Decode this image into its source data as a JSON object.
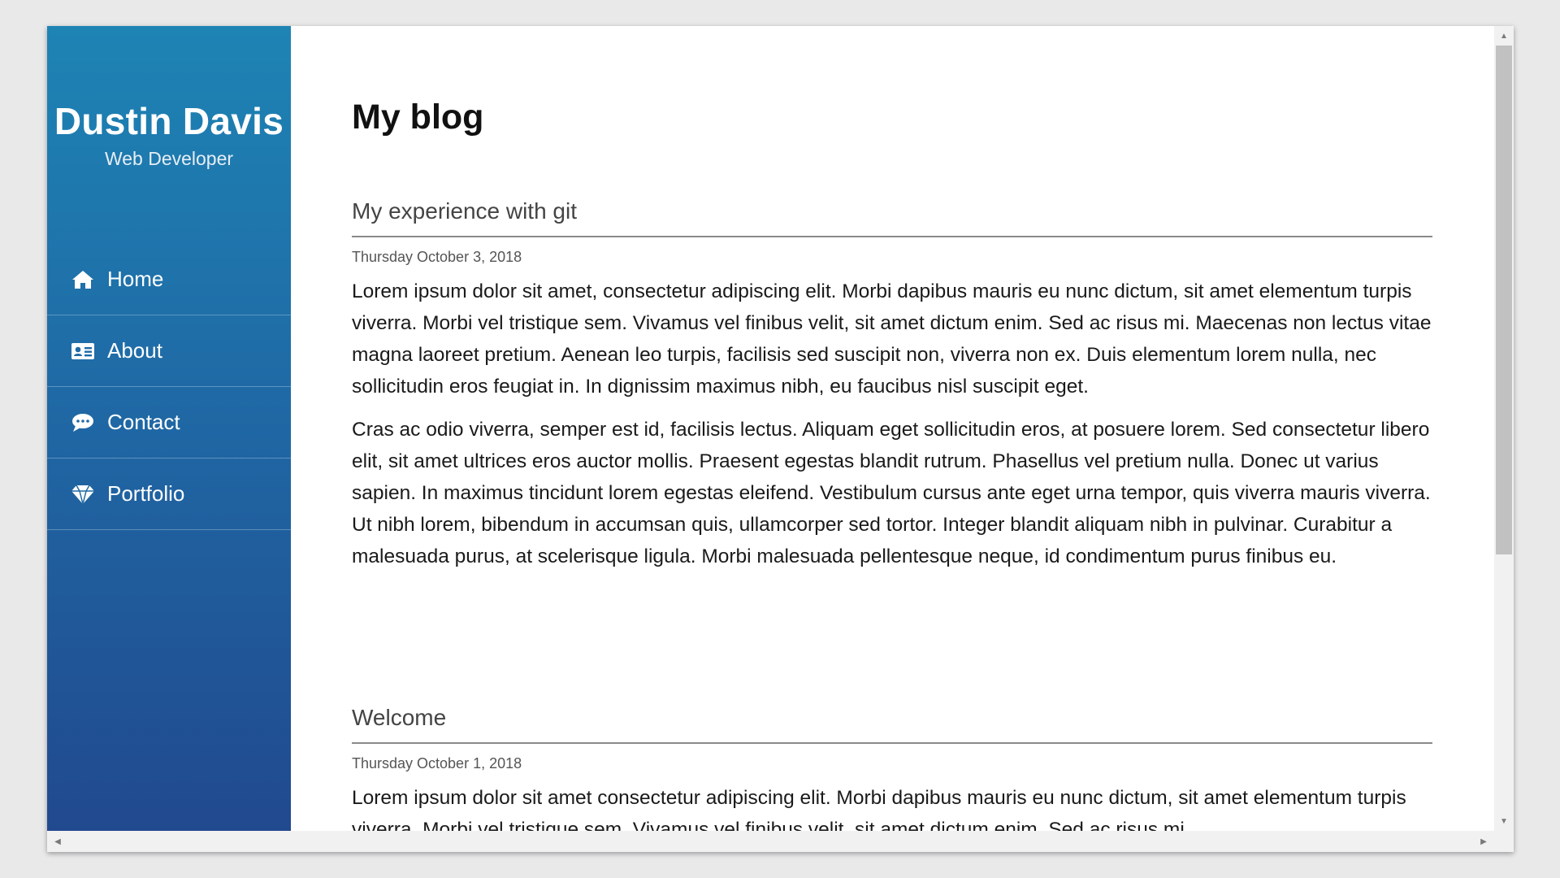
{
  "sidebar": {
    "name": "Dustin Davis",
    "tagline": "Web Developer",
    "gradient_top": "#1e84b4",
    "gradient_bottom": "#21498f",
    "items": [
      {
        "label": "Home",
        "icon": "home-icon"
      },
      {
        "label": "About",
        "icon": "id-card-icon"
      },
      {
        "label": "Contact",
        "icon": "comment-icon"
      },
      {
        "label": "Portfolio",
        "icon": "diamond-icon"
      }
    ]
  },
  "main": {
    "title": "My blog",
    "posts": [
      {
        "title": "My experience with git",
        "date": "Thursday October 3, 2018",
        "paragraphs": [
          "Lorem ipsum dolor sit amet, consectetur adipiscing elit. Morbi dapibus mauris eu nunc dictum, sit amet elementum turpis viverra. Morbi vel tristique sem. Vivamus vel finibus velit, sit amet dictum enim. Sed ac risus mi. Maecenas non lectus vitae magna laoreet pretium. Aenean leo turpis, facilisis sed suscipit non, viverra non ex. Duis elementum lorem nulla, nec sollicitudin eros feugiat in. In dignissim maximus nibh, eu faucibus nisl suscipit eget.",
          "Cras ac odio viverra, semper est id, facilisis lectus. Aliquam eget sollicitudin eros, at posuere lorem. Sed consectetur libero elit, sit amet ultrices eros auctor mollis. Praesent egestas blandit rutrum. Phasellus vel pretium nulla. Donec ut varius sapien. In maximus tincidunt lorem egestas eleifend. Vestibulum cursus ante eget urna tempor, quis viverra mauris viverra. Ut nibh lorem, bibendum in accumsan quis, ullamcorper sed tortor. Integer blandit aliquam nibh in pulvinar. Curabitur a malesuada purus, at scelerisque ligula. Morbi malesuada pellentesque neque, id condimentum purus finibus eu."
        ]
      },
      {
        "title": "Welcome",
        "date": "Thursday October 1, 2018",
        "paragraphs": [
          "Lorem ipsum dolor sit amet consectetur adipiscing elit. Morbi dapibus mauris eu nunc dictum, sit amet elementum turpis viverra. Morbi vel tristique sem. Vivamus vel finibus velit, sit amet dictum enim. Sed ac risus mi."
        ]
      }
    ]
  },
  "scrollbars": {
    "up": "▲",
    "down": "▼",
    "left": "◀",
    "right": "▶"
  }
}
